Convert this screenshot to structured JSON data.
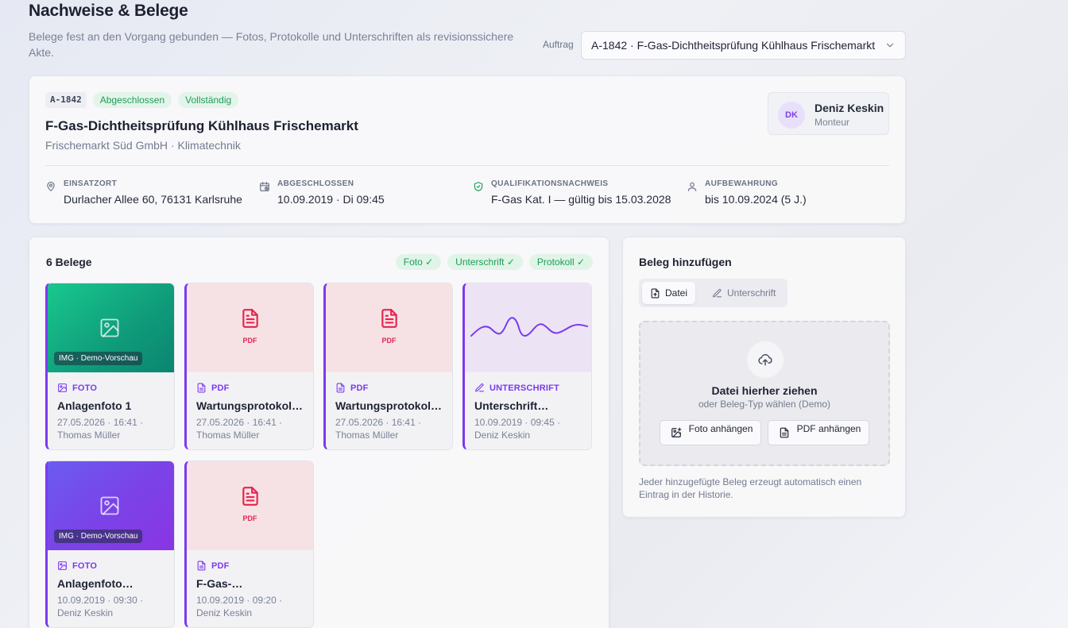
{
  "header": {
    "title": "Nachweise & Belege",
    "subtitle": "Belege fest an den Vorgang gebunden — Fotos, Protokolle und Unterschriften als revisionssichere Akte.",
    "auftrag_label": "Auftrag",
    "auftrag_value": "A-1842 · F-Gas-Dichtheitsprüfung Kühlhaus Frischemarkt"
  },
  "case": {
    "code": "A-1842",
    "status": "Abgeschlossen",
    "completeness": "Vollständig",
    "title": "F-Gas-Dichtheitsprüfung Kühlhaus Frischemarkt",
    "customer": "Frischemarkt Süd GmbH · Klimatechnik",
    "technician": {
      "initials": "DK",
      "name": "Deniz Keskin",
      "role": "Monteur"
    },
    "meta": [
      {
        "label": "EINSATZORT",
        "value": "Durlacher Allee 60, 76131 Karlsruhe",
        "icon": "map-pin-icon"
      },
      {
        "label": "ABGESCHLOSSEN",
        "value": "10.09.2019 · Di 09:45",
        "icon": "calendar-check-icon"
      },
      {
        "label": "QUALIFIKATIONSNACHWEIS",
        "value": "F-Gas Kat. I — gültig bis 15.03.2028",
        "icon": "shield-check-icon"
      },
      {
        "label": "AUFBEWAHRUNG",
        "value": "bis 10.09.2024 (5 J.)",
        "icon": "user-icon"
      }
    ]
  },
  "belege": {
    "heading": "6 Belege",
    "chips": [
      "Foto ✓",
      "Unterschrift ✓",
      "Protokoll ✓"
    ],
    "demo_label": "IMG · Demo-Vorschau",
    "pdf_label": "PDF",
    "items": [
      {
        "kind": "FOTO",
        "name": "Anlagenfoto 1",
        "date": "27.05.2026 · 16:41 ·",
        "author": "Thomas Müller"
      },
      {
        "kind": "PDF",
        "name": "Wartungsprotokoll…",
        "date": "27.05.2026 · 16:41 ·",
        "author": "Thomas Müller"
      },
      {
        "kind": "PDF",
        "name": "Wartungsprotokoll…",
        "date": "27.05.2026 · 16:41 ·",
        "author": "Thomas Müller"
      },
      {
        "kind": "UNTERSCHRIFT",
        "name": "Unterschrift…",
        "date": "10.09.2019 · 09:45 ·",
        "author": "Deniz Keskin"
      },
      {
        "kind": "FOTO",
        "name": "Anlagenfoto…",
        "date": "10.09.2019 · 09:30 ·",
        "author": "Deniz Keskin"
      },
      {
        "kind": "PDF",
        "name": "F-Gas-…",
        "date": "10.09.2019 · 09:20 ·",
        "author": "Deniz Keskin"
      }
    ]
  },
  "add": {
    "heading": "Beleg hinzufügen",
    "tab_file": "Datei",
    "tab_signature": "Unterschrift",
    "drop_title": "Datei hierher ziehen",
    "drop_sub": "oder Beleg-Typ wählen (Demo)",
    "btn_photo": "Foto anhängen",
    "btn_pdf": "PDF anhängen",
    "note": "Jeder hinzugefügte Beleg erzeugt automatisch einen Eintrag in der Historie."
  },
  "colors": {
    "accent": "#7c3aed",
    "success": "#1f9d58",
    "pdf": "#e5254f"
  }
}
